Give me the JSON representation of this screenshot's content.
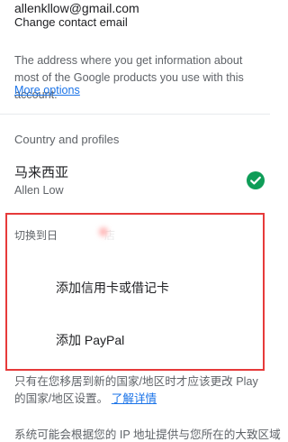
{
  "account": {
    "email": "allenkllow@gmail.com",
    "change_email": "Change contact email",
    "description": "The address where you get information about most of the Google products you use with this account.",
    "more_options": "More options"
  },
  "profiles": {
    "section_title": "Country and profiles",
    "country_name": "马来西亚",
    "profile_name": "Allen Low",
    "check_icon": "check-circle-icon",
    "check_color": "#0f9d58"
  },
  "payment": {
    "switch_label": "切换到日",
    "switch_label_suffix": "店",
    "add_card": "添加信用卡或借记卡",
    "add_paypal": "添加 PayPal",
    "highlight_color": "#e63a3a"
  },
  "note": {
    "text": "只有在您移居到新的国家/地区时才应该更改 Play 的国家/地区设置。",
    "learn_more": "了解详情",
    "bottom_text": "系统可能会根据您的 IP 地址提供与您所在的大致区域"
  }
}
